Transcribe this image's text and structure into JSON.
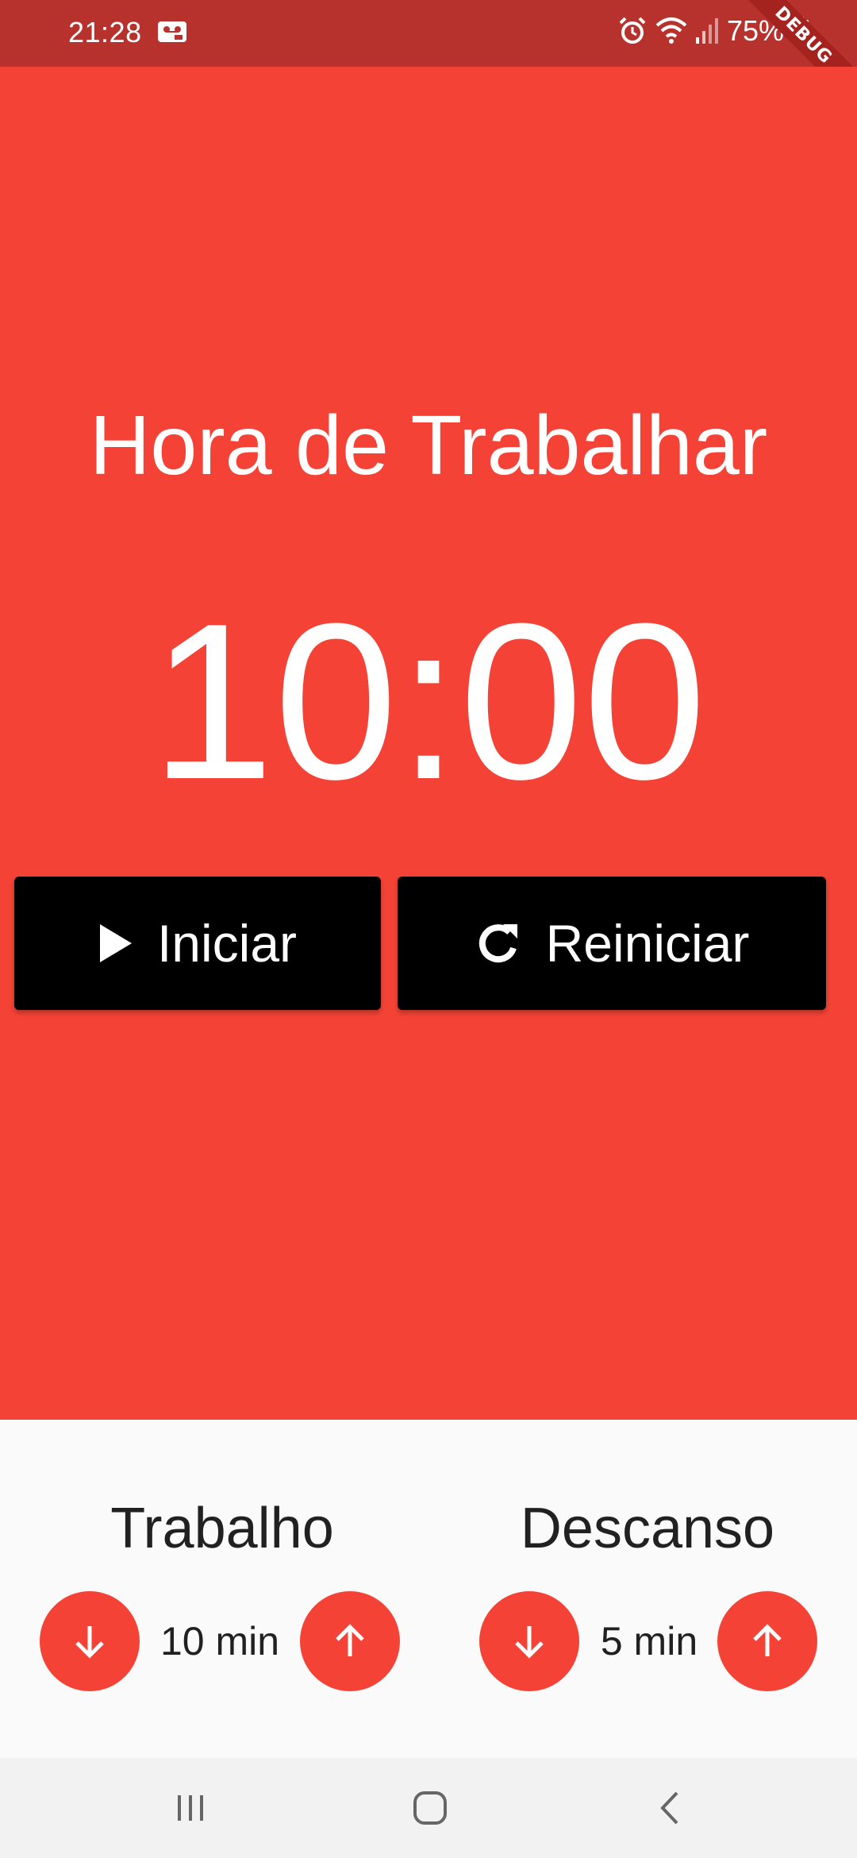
{
  "status_bar": {
    "time": "21:28",
    "battery_percent": "75%",
    "icons": [
      "voicemail-icon",
      "alarm-icon",
      "wifi-icon",
      "signal-icon",
      "battery-icon"
    ]
  },
  "debug_banner": "DEBUG",
  "main": {
    "title": "Hora de Trabalhar",
    "timer": "10:00",
    "start_button": {
      "label": "Iniciar",
      "icon": "play-icon"
    },
    "reset_button": {
      "label": "Reiniciar",
      "icon": "refresh-icon"
    }
  },
  "settings": {
    "work": {
      "title": "Trabalho",
      "value": "10 min"
    },
    "rest": {
      "title": "Descanso",
      "value": "5 min"
    }
  },
  "navigation": {
    "icons": [
      "recent-apps-icon",
      "home-icon",
      "back-icon"
    ]
  },
  "colors": {
    "accent": "#f44336",
    "status_bar": "#b7322c",
    "buttons": "#000000",
    "panel": "#fafafa"
  }
}
